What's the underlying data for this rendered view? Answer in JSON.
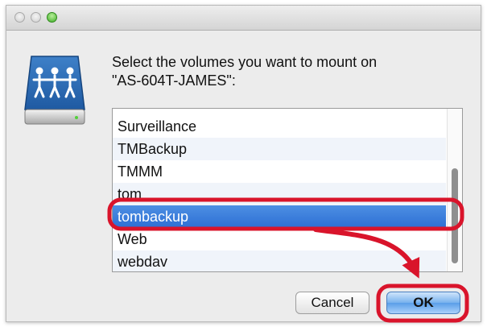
{
  "dialog": {
    "prompt_line1": "Select the volumes you want to mount on",
    "prompt_line2": "\"AS-604T-JAMES\":"
  },
  "volumes": {
    "items": [
      {
        "label": "Surveillance",
        "selected": false
      },
      {
        "label": "TMBackup",
        "selected": false
      },
      {
        "label": "TMMM",
        "selected": false
      },
      {
        "label": "tom",
        "selected": false
      },
      {
        "label": "tombackup",
        "selected": true
      },
      {
        "label": "Web",
        "selected": false
      },
      {
        "label": "webdav",
        "selected": false
      }
    ]
  },
  "buttons": {
    "cancel_label": "Cancel",
    "ok_label": "OK"
  },
  "icons": {
    "server": "network-server-icon",
    "close": "close-window-icon",
    "minimize": "minimize-window-icon",
    "zoom": "zoom-window-icon"
  },
  "colors": {
    "selection": "#3a7bd9",
    "annotation": "#d9142b",
    "zoom_button": "#3fae28"
  }
}
